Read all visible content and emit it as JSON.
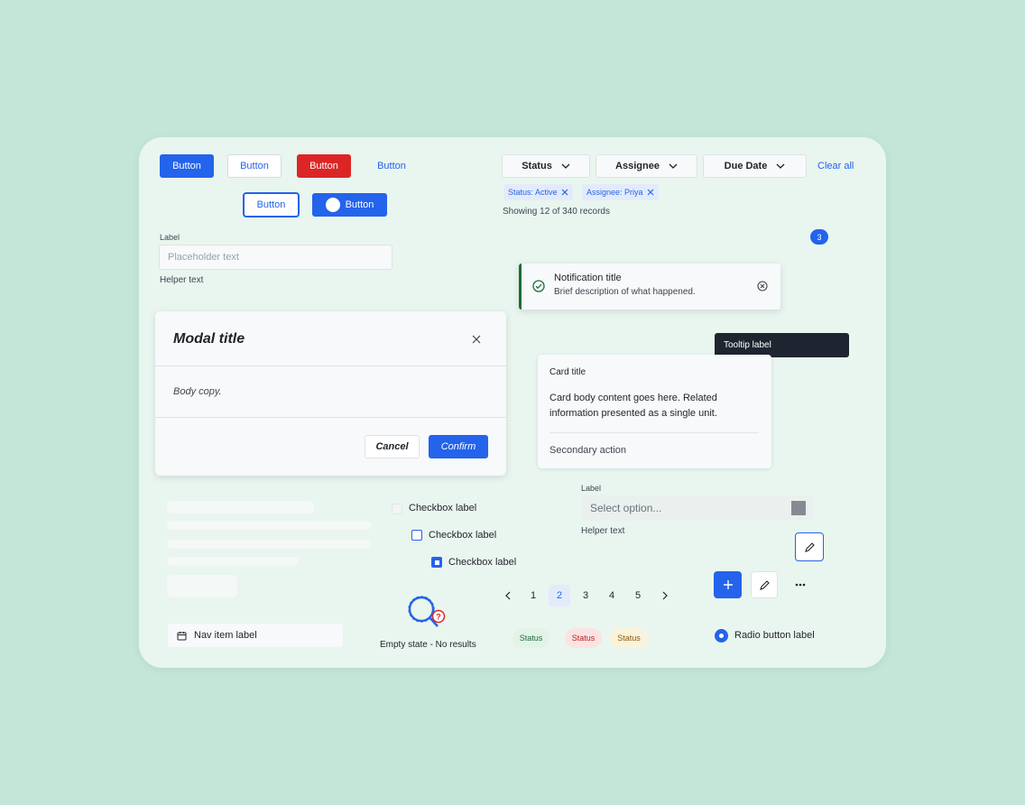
{
  "buttons": {
    "primary": "Button",
    "secondary": "Button",
    "danger": "Button",
    "ghost": "Button",
    "outline": "Button",
    "toggle": "Button"
  },
  "filters": {
    "status": "Status",
    "assignee": "Assignee",
    "due_date": "Due Date",
    "clear_all": "Clear all",
    "chips": [
      "Status: Active",
      "Assignee: Priya"
    ],
    "summary": "Showing 12 of 340 records"
  },
  "badge": {
    "count": "3"
  },
  "text_field": {
    "label": "Label",
    "placeholder": "Placeholder text",
    "helper": "Helper text"
  },
  "notification": {
    "title": "Notification title",
    "description": "Brief description of what happened."
  },
  "tooltip": {
    "label": "Tooltip label"
  },
  "modal": {
    "title": "Modal title",
    "body": "Body copy.",
    "cancel": "Cancel",
    "confirm": "Confirm"
  },
  "card": {
    "title": "Card title",
    "body": "Card body content goes here. Related information presented as a single unit.",
    "action": "Secondary action"
  },
  "checkboxes": [
    "Checkbox label",
    "Checkbox label",
    "Checkbox label"
  ],
  "select": {
    "label": "Label",
    "placeholder": "Select option...",
    "helper": "Helper text"
  },
  "pagination": {
    "pages": [
      "1",
      "2",
      "3",
      "4",
      "5"
    ],
    "current": "2"
  },
  "nav_item": {
    "label": "Nav item label"
  },
  "empty_state": {
    "label": "Empty state - No results"
  },
  "status_pills": [
    "Status",
    "Status",
    "Status"
  ],
  "radio": {
    "label": "Radio button label"
  },
  "colors": {
    "primary": "#2463eb",
    "danger": "#dc2626",
    "success": "#1f6b3a",
    "tooltip_bg": "#1f2530"
  }
}
